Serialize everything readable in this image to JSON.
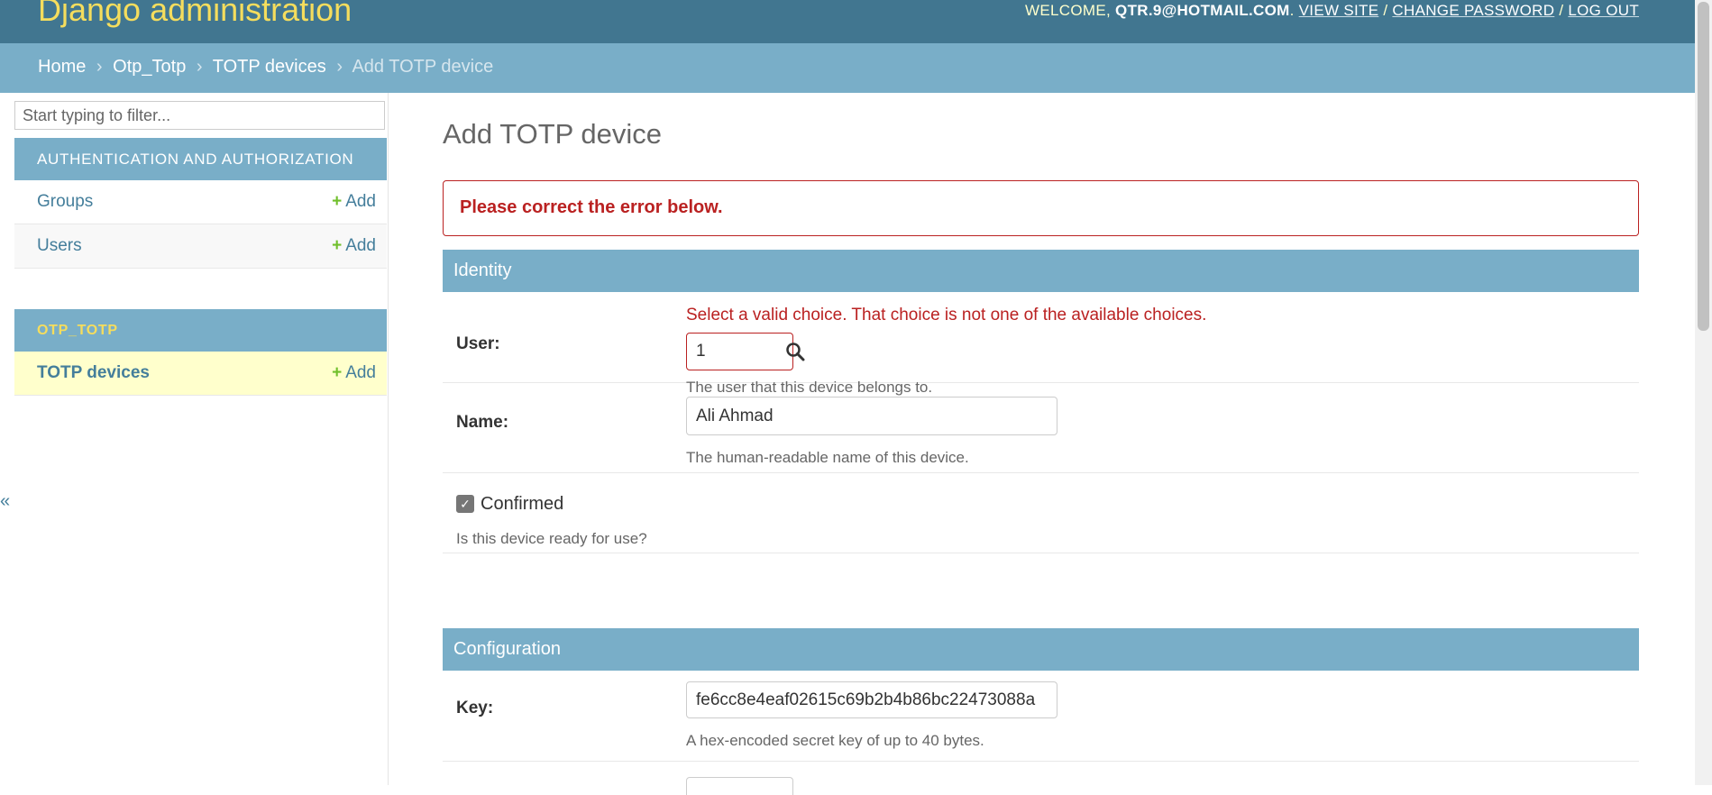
{
  "header": {
    "brand": "Django administration",
    "welcome_prefix": "WELCOME,",
    "username": "QTR.9@HOTMAIL.COM",
    "view_site": "VIEW SITE",
    "change_password": "CHANGE PASSWORD",
    "log_out": "LOG OUT",
    "separator": "/"
  },
  "breadcrumbs": {
    "home": "Home",
    "app": "Otp_Totp",
    "model": "TOTP devices",
    "current": "Add TOTP device",
    "separator": "›"
  },
  "sidebar": {
    "filter_placeholder": "Start typing to filter...",
    "modules": [
      {
        "caption": "AUTHENTICATION AND AUTHORIZATION",
        "items": [
          {
            "name": "Groups",
            "add": "Add"
          },
          {
            "name": "Users",
            "add": "Add"
          }
        ]
      },
      {
        "caption": "OTP_TOTP",
        "items": [
          {
            "name": "TOTP devices",
            "add": "Add"
          }
        ]
      }
    ],
    "collapse_glyph": "«"
  },
  "main": {
    "title": "Add TOTP device",
    "error_note": "Please correct the error below.",
    "fieldsets": [
      {
        "caption": "Identity"
      },
      {
        "caption": "Configuration"
      }
    ],
    "fields": {
      "user": {
        "label": "User:",
        "error": "Select a valid choice. That choice is not one of the available choices.",
        "value": "1",
        "help": "The user that this device belongs to."
      },
      "name": {
        "label": "Name:",
        "value": "Ali Ahmad",
        "help": "The human-readable name of this device."
      },
      "confirmed": {
        "label": "Confirmed",
        "checked": true,
        "help": "Is this device ready for use?"
      },
      "key": {
        "label": "Key:",
        "value": "fe6cc8e4eaf02615c69b2b4b86bc22473088a",
        "help": "A hex-encoded secret key of up to 40 bytes."
      }
    }
  },
  "colors": {
    "header_bg": "#417690",
    "brand": "#f5dd5d",
    "breadcrumbs_bg": "#79aec8",
    "link": "#447e9b",
    "error": "#ba2121",
    "add_plus": "#70bf2b",
    "active_row": "#ffffcc"
  },
  "icons": [
    "plus-icon",
    "search-icon",
    "checkbox-checked-icon",
    "collapse-sidebar-icon"
  ]
}
